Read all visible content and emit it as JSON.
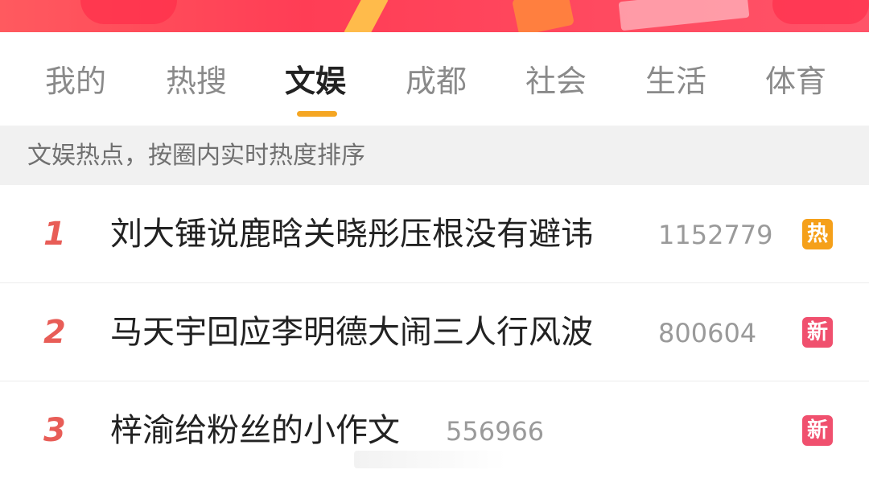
{
  "tabs": [
    {
      "label": "我的"
    },
    {
      "label": "热搜"
    },
    {
      "label": "文娱"
    },
    {
      "label": "成都"
    },
    {
      "label": "社会"
    },
    {
      "label": "生活"
    },
    {
      "label": "体育"
    }
  ],
  "active_tab_index": 2,
  "subheader": "文娱热点，按圈内实时热度排序",
  "items": [
    {
      "rank": "1",
      "title": "刘大锤说鹿晗关晓彤压根没有避讳",
      "heat": "1152779",
      "badge": "热",
      "badge_color": "#f5a01a"
    },
    {
      "rank": "2",
      "title": "马天宇回应李明德大闹三人行风波",
      "heat": "800604",
      "badge": "新",
      "badge_color": "#f0506e"
    },
    {
      "rank": "3",
      "title": "梓渝给粉丝的小作文",
      "heat": "556966",
      "badge": "新",
      "badge_color": "#f0506e"
    }
  ],
  "colors": {
    "accent_underline": "#f5a623",
    "rank": "#e85d57",
    "banner": "#ff4a60"
  }
}
